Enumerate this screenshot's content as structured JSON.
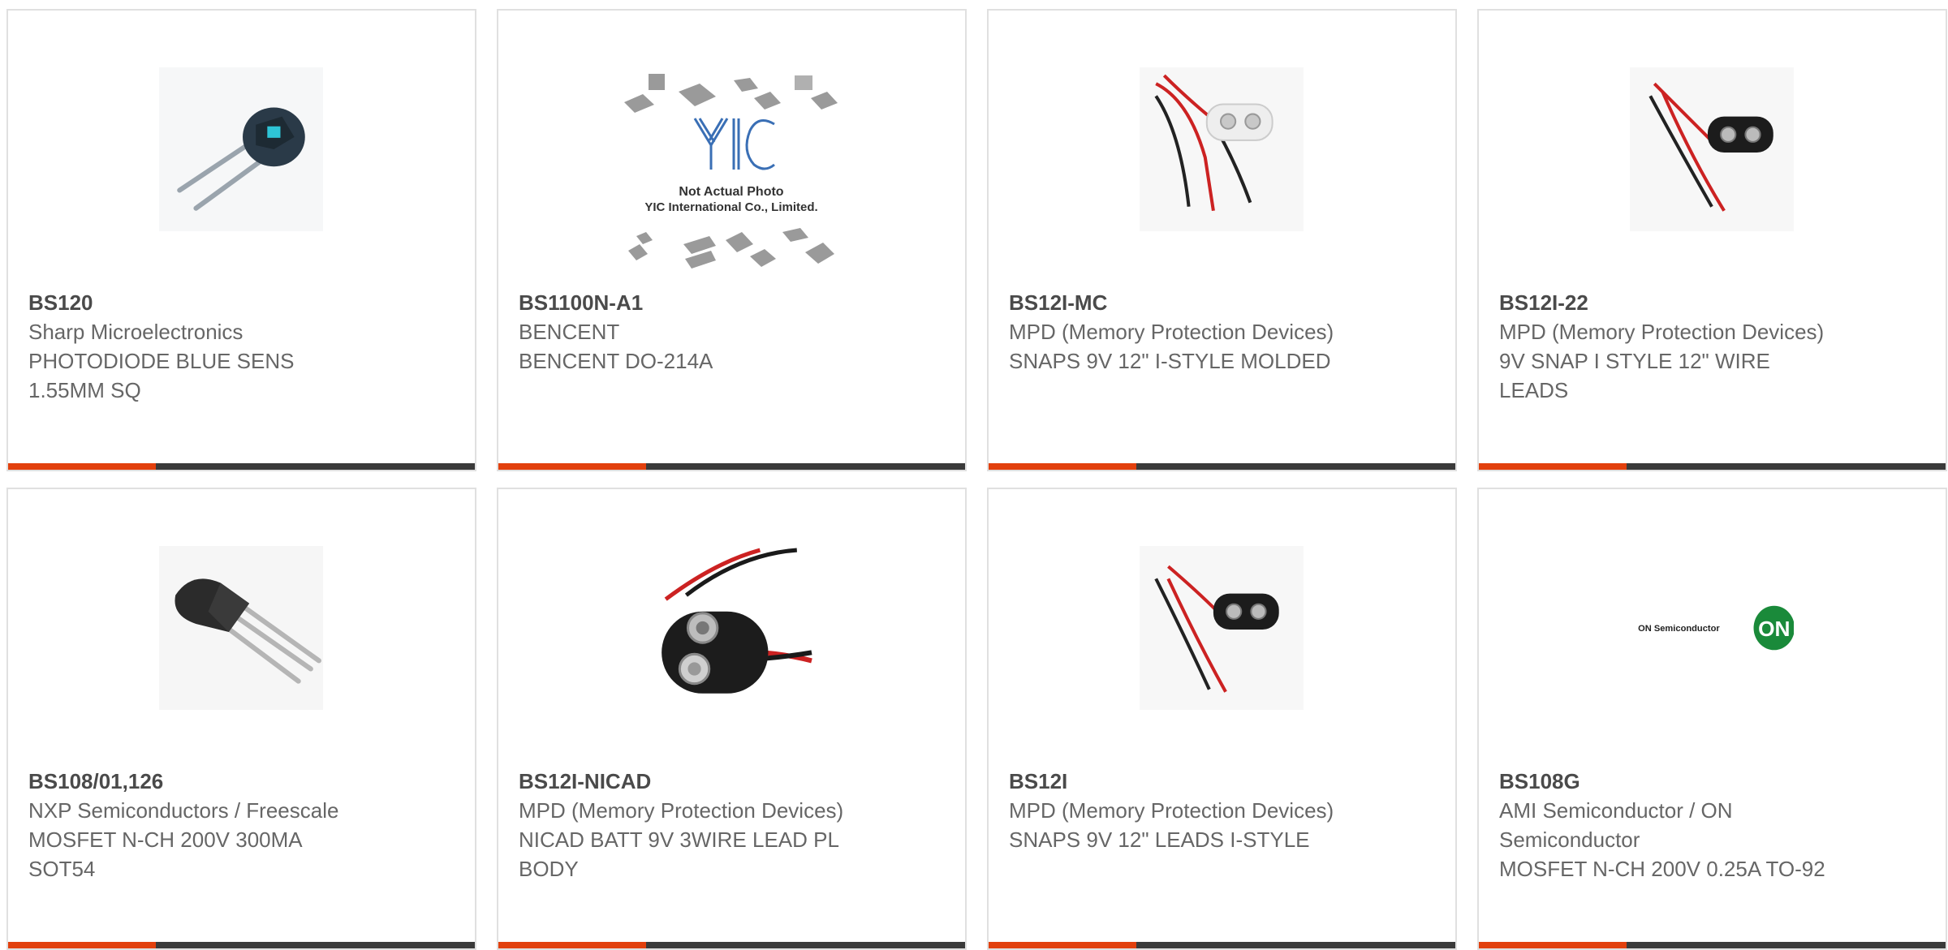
{
  "colors": {
    "accent": "#e2400d",
    "bar": "#3a3a3a",
    "border": "#e0e0e0",
    "text": "#666666"
  },
  "products": [
    {
      "part_number": "BS120",
      "manufacturer": "Sharp Microelectronics",
      "description": "PHOTODIODE BLUE SENS 1.55MM SQ",
      "image": "photodiode-icon"
    },
    {
      "part_number": "BS1100N-A1",
      "manufacturer": "BENCENT",
      "description": "BENCENT DO-214A",
      "image": "placeholder-photo",
      "placeholder_line1": "Not Actual Photo",
      "placeholder_line2": "YIC International Co., Limited.",
      "placeholder_logo": "YIC"
    },
    {
      "part_number": "BS12I-MC",
      "manufacturer": "MPD (Memory Protection Devices)",
      "description": "SNAPS 9V 12\" I-STYLE MOLDED",
      "image": "battery-snap-white-icon"
    },
    {
      "part_number": "BS12I-22",
      "manufacturer": "MPD (Memory Protection Devices)",
      "description": "9V SNAP I STYLE 12\" WIRE LEADS",
      "image": "battery-snap-black-icon"
    },
    {
      "part_number": "BS108/01,126",
      "manufacturer": "NXP Semiconductors / Freescale",
      "description": "MOSFET N-CH 200V 300MA SOT54",
      "image": "to92-transistor-icon"
    },
    {
      "part_number": "BS12I-NICAD",
      "manufacturer": "MPD (Memory Protection Devices)",
      "description": "NICAD BATT 9V 3WIRE LEAD PL BODY",
      "image": "battery-snap-large-icon"
    },
    {
      "part_number": "BS12I",
      "manufacturer": "MPD (Memory Protection Devices)",
      "description": "SNAPS 9V 12\" LEADS I-STYLE",
      "image": "battery-snap-black-icon"
    },
    {
      "part_number": "BS108G",
      "manufacturer": "AMI Semiconductor / ON Semiconductor",
      "description": "MOSFET N-CH 200V 0.25A TO-92",
      "image": "on-semiconductor-logo",
      "logo_text": "ON Semiconductor",
      "logo_badge": "ON"
    }
  ]
}
